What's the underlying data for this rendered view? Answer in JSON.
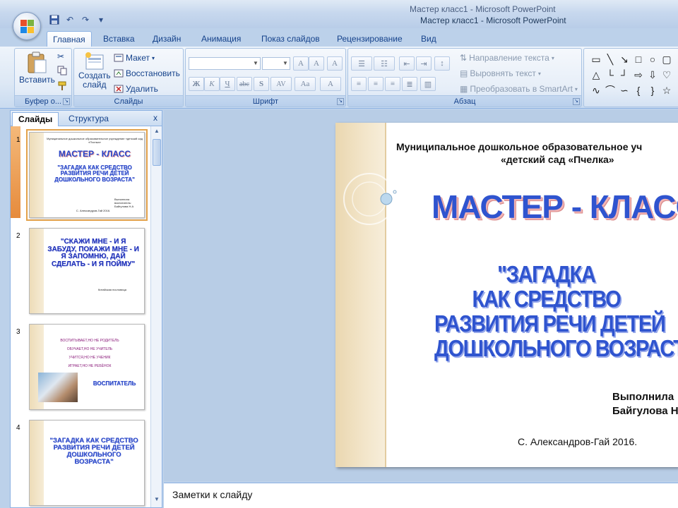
{
  "app": {
    "title": "Мастер класс1 - Microsoft PowerPoint",
    "ghost_title": "Мастер класс1 - Microsoft PowerPoint"
  },
  "tabs": [
    "Главная",
    "Вставка",
    "Дизайн",
    "Анимация",
    "Показ слайдов",
    "Рецензирование",
    "Вид"
  ],
  "ribbon": {
    "clipboard": {
      "paste": "Вставить",
      "label": "Буфер о..."
    },
    "slides": {
      "new_line1": "Создать",
      "new_line2": "слайд",
      "layout": "Макет",
      "reset": "Восстановить",
      "delete": "Удалить",
      "label": "Слайды"
    },
    "font": {
      "label": "Шрифт",
      "bold": "Ж",
      "italic": "К",
      "underline": "Ч",
      "strike": "abc",
      "shadow": "S",
      "spacing": "AV",
      "case": "Aa",
      "color": "A",
      "grow": "A",
      "shrink": "A",
      "clear": "A"
    },
    "paragraph": {
      "label": "Абзац",
      "text_direction": "Направление текста",
      "align_text": "Выровнять текст",
      "smartart": "Преобразовать в SmartArt"
    }
  },
  "left_pane": {
    "tabs": [
      "Слайды",
      "Структура"
    ],
    "close": "x"
  },
  "thumbs": [
    {
      "num": "1",
      "org": "Муниципальное дошкольное образовательное учреждение «детский сад «Пчелка»",
      "title": "МАСТЕР - КЛАСС",
      "sub": "\"ЗАГАДКА КАК СРЕДСТВО РАЗВИТИЯ РЕЧИ ДЕТЕЙ ДОШКОЛЬНОГО ВОЗРАСТА\"",
      "author": "Выполнила воспитатель: Байгулова Н.А",
      "place": "С. Александров-Гай 2016."
    },
    {
      "num": "2",
      "quote": "\"СКАЖИ МНЕ - И Я ЗАБУДУ, ПОКАЖИ МНЕ - И Я ЗАПОМНЮ, ДАЙ СДЕЛАТЬ - И Я ПОЙМУ\"",
      "source": "Китайская пословица"
    },
    {
      "num": "3",
      "lines": [
        "ВОСПИТЫВАЕТ,НО НЕ РОДИТЕЛЬ",
        "ОБУЧАЕТ,НО НЕ УЧИТЕЛЬ",
        "УЧИТСЯ,НО НЕ УЧЕНИК",
        "ИГРАЕТ,НО НЕ РЕБЁНОК"
      ],
      "answer": "ВОСПИТАТЕЛЬ"
    },
    {
      "num": "4",
      "sub": "\"ЗАГАДКА КАК СРЕДСТВО РАЗВИТИЯ РЕЧИ ДЕТЕЙ ДОШКОЛЬНОГО ВОЗРАСТА\""
    }
  ],
  "slide": {
    "org_line1": "Муниципальное дошкольное образовательное уч",
    "org_line2": "«детский сад «Пчелка»",
    "title": "МАСТЕР - КЛАСС",
    "sub_lines": [
      "\"ЗАГАДКА",
      "КАК СРЕДСТВО",
      "РАЗВИТИЯ РЕЧИ ДЕТЕЙ",
      "ДОШКОЛЬНОГО ВОЗРАСТА\""
    ],
    "author_line1": "Выполнила",
    "author_line2": "Байгулова Н",
    "place": "С. Александров-Гай 2016."
  },
  "notes": {
    "placeholder": "Заметки к слайду"
  },
  "colors": {
    "accent": "#2f54cf",
    "ribbon": "#dde8f5",
    "selection": "#e68b3c"
  }
}
